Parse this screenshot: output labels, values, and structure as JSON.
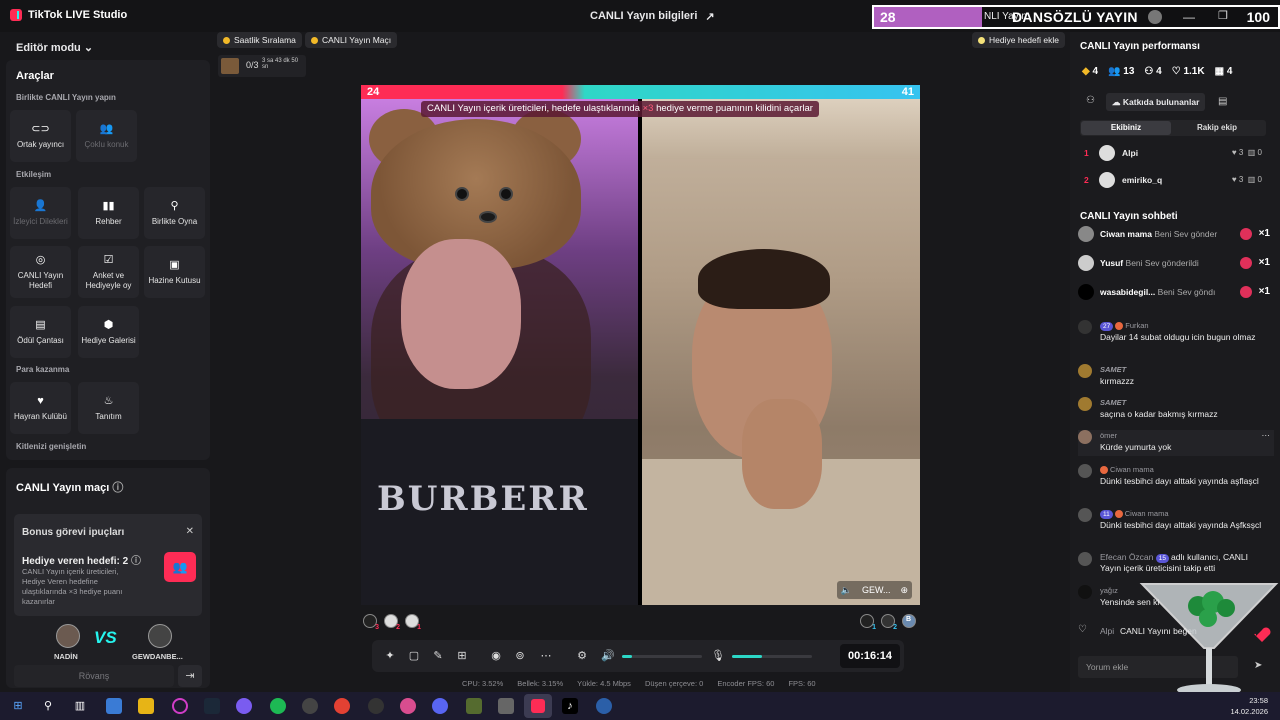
{
  "app": {
    "title": "TikTok LIVE Studio",
    "center_title": "CANLI Yayın bilgileri"
  },
  "overlay": {
    "left_num": "28",
    "snippet": "NLI Yayın",
    "banner": "DANSÖZLÜ YAYIN",
    "right_num": "100"
  },
  "left": {
    "editor_mode": "Editör modu",
    "tools_title": "Araçlar",
    "group_together": "Birlikte CANLI Yayın yapın",
    "tiles_together": [
      {
        "label": "Ortak yayıncı",
        "icon": "link-icon",
        "disabled": false
      },
      {
        "label": "Çoklu konuk",
        "icon": "users-icon",
        "disabled": true
      }
    ],
    "group_interaction": "Etkileşim",
    "tiles_interaction": [
      {
        "label": "İzleyici Dilekleri",
        "icon": "viewer-icon",
        "disabled": true
      },
      {
        "label": "Rehber",
        "icon": "book-icon",
        "disabled": false
      },
      {
        "label": "Birlikte Oyna",
        "icon": "joystick-icon",
        "disabled": false
      },
      {
        "label": "CANLI Yayın Hedefi",
        "icon": "target-icon",
        "disabled": false
      },
      {
        "label": "Anket ve Hediyeyle oy",
        "icon": "poll-icon",
        "disabled": false
      },
      {
        "label": "Hazine Kutusu",
        "icon": "chest-icon",
        "disabled": false
      },
      {
        "label": "Ödül Çantası",
        "icon": "bag-icon",
        "disabled": false
      },
      {
        "label": "Hediye Galerisi",
        "icon": "gallery-icon",
        "disabled": false
      }
    ],
    "group_earn": "Para kazanma",
    "tiles_earn": [
      {
        "label": "Hayran Kulübü",
        "icon": "heart-icon",
        "disabled": false
      },
      {
        "label": "Tanıtım",
        "icon": "flame-icon",
        "disabled": false
      }
    ],
    "group_expand": "Kitlenizi genişletin",
    "match_title": "CANLI Yayın maçı",
    "bonus_title": "Bonus görevi ipuçları",
    "gifter_goal": "Hediye veren hedefi: 2",
    "bonus_desc": "CANLI Yayın içerik üreticileri, Hediye Veren hedefine ulaştıklarında ×3 hediye puanı kazanırlar",
    "player_left": "NADİN",
    "player_right": "GEWDANBE...",
    "vs_v": "V",
    "vs_s": "S",
    "rematch": "Rövanş"
  },
  "center": {
    "pill_hourly": "Saatlik Sıralama",
    "pill_match": "CANLI Yayın Maçı",
    "pill_gift_goal": "Hediye hedefi ekle",
    "chip_fraction": "0/3",
    "chip_timer": "3 sa 43 dk 50 sn",
    "score_left": "24",
    "score_right": "41",
    "notice_pre": "CANLI Yayın içerik üreticileri, hedefe ulaştıklarında ",
    "notice_x3": "×3",
    "notice_post": " hediye verme puanının kilidini açarlar",
    "shirt_text": "BURBERR",
    "opponent_tag": "GEW...",
    "timer": "00:16:14",
    "mic_level": 0.38,
    "speaker_level": 0.12,
    "stats": [
      "CPU: 3.52%",
      "Bellek: 3.15%",
      "Yükle: 4.5 Mbps",
      "Düşen çerçeve: 0",
      "Encoder FPS: 60",
      "FPS: 60"
    ],
    "team_left_badges": [
      "3",
      "2",
      "1"
    ],
    "team_right_badges": [
      "1",
      "2",
      "B"
    ]
  },
  "right": {
    "perf_title": "CANLI Yayın performansı",
    "metrics": [
      "4",
      "13",
      "4",
      "1.1K",
      "4"
    ],
    "contributors": "Katkıda bulunanlar",
    "tab_team": "Ekibiniz",
    "tab_rival": "Rakip ekip",
    "ranks": [
      {
        "n": "1",
        "name": "Alpi",
        "likes": "3",
        "gifts": "0"
      },
      {
        "n": "2",
        "name": "emiriko_q",
        "likes": "3",
        "gifts": "0"
      }
    ],
    "chat_title": "CANLI Yayın sohbeti",
    "gifts": [
      {
        "name": "Ciwan mama",
        "action": "Beni Sev gönder",
        "count": "×1"
      },
      {
        "name": "Yusuf",
        "action": "Beni Sev gönderildi",
        "count": "×1"
      },
      {
        "name": "wasabidegil...",
        "action": "Beni Sev göndı",
        "count": "×1"
      }
    ],
    "messages": [
      {
        "level": "27",
        "who": "Furkan",
        "msg": "Dayilar 14 subat oldugu icin bugun olmaz"
      },
      {
        "level": "",
        "who": "SAMET",
        "msg": "kırmazzz"
      },
      {
        "level": "",
        "who": "SAMET",
        "msg": "saçına o kadar bakmış kırmazz"
      },
      {
        "level": "",
        "who": "ömer",
        "msg": "Kürde yumurta yok"
      },
      {
        "level": "",
        "who": "Ciwan mama",
        "msg": "Dünki tesbihci dayı alttaki yayında aşflaşcl"
      },
      {
        "level": "11",
        "who": "Ciwan mama",
        "msg": "Dünki tesbihci dayı alttaki yayında Aşfksşcl"
      },
      {
        "level": "15",
        "who": "Efecan Özcan",
        "msg": "adlı kullanıcı, CANLI Yayın içerik üreticisini takip etti"
      },
      {
        "level": "",
        "who": "yağız",
        "msg": "Yensinde sen ki"
      },
      {
        "level": "",
        "who": "Alpi",
        "msg": "CANLI Yayını beğen"
      }
    ],
    "comment_placeholder": "Yorum ekle"
  },
  "taskbar": {
    "time": "23:58",
    "date": "14.02.2026"
  }
}
